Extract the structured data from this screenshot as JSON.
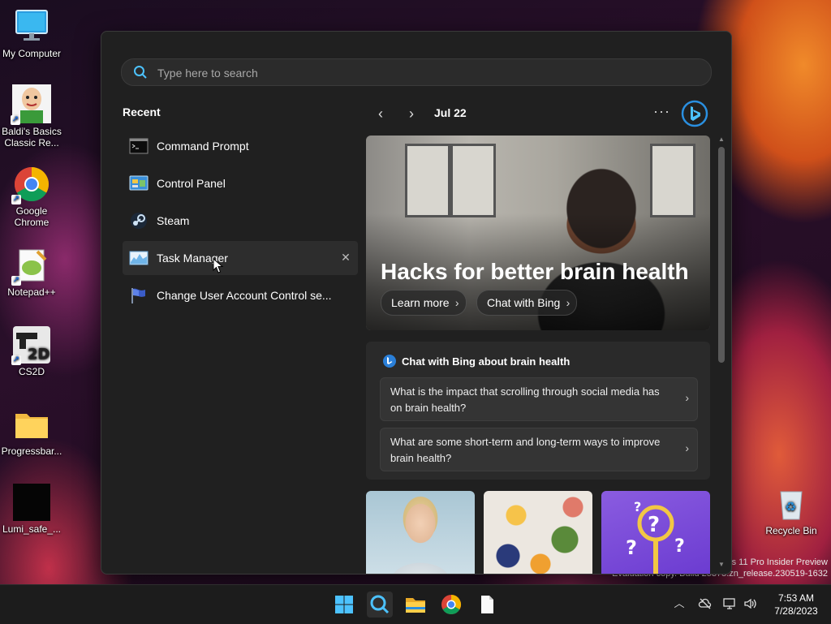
{
  "desktop": {
    "icons": [
      {
        "label": "My Computer"
      },
      {
        "label": "Baldi's Basics Classic Re..."
      },
      {
        "label": "Google Chrome"
      },
      {
        "label": "Notepad++"
      },
      {
        "label": "CS2D"
      },
      {
        "label": "Progressbar..."
      },
      {
        "label": "Lumi_safe_..."
      },
      {
        "label": "Recycle Bin"
      }
    ],
    "watermark": {
      "line1": "s 11 Pro Insider Preview",
      "line2": "Evaluation copy. Build 25375.zn_release.230519-1632"
    }
  },
  "start_menu": {
    "search": {
      "placeholder": "Type here to search",
      "value": ""
    },
    "recent": {
      "title": "Recent",
      "items": [
        {
          "label": "Command Prompt",
          "icon": "command-prompt-icon"
        },
        {
          "label": "Control Panel",
          "icon": "control-panel-icon"
        },
        {
          "label": "Steam",
          "icon": "steam-icon"
        },
        {
          "label": "Task Manager",
          "icon": "task-manager-icon",
          "remove": "✕"
        },
        {
          "label": "Change User Account Control se...",
          "icon": "uac-flag-icon"
        }
      ]
    },
    "feed": {
      "date": "Jul 22",
      "more": "···",
      "hero": {
        "title": "Hacks for better brain health",
        "learn_more": "Learn more",
        "chat_with_bing": "Chat with Bing"
      },
      "chat": {
        "title": "Chat with Bing about brain health",
        "questions": [
          "What is the impact that scrolling through social media has on brain health?",
          "What are some short-term and long-term ways to improve brain health?"
        ]
      }
    }
  },
  "taskbar": {
    "time": "7:53 AM",
    "date": "7/28/2023"
  },
  "colors": {
    "accent": "#4cc2ff",
    "panel": "#202020",
    "taskbar": "#1c1c1c"
  }
}
